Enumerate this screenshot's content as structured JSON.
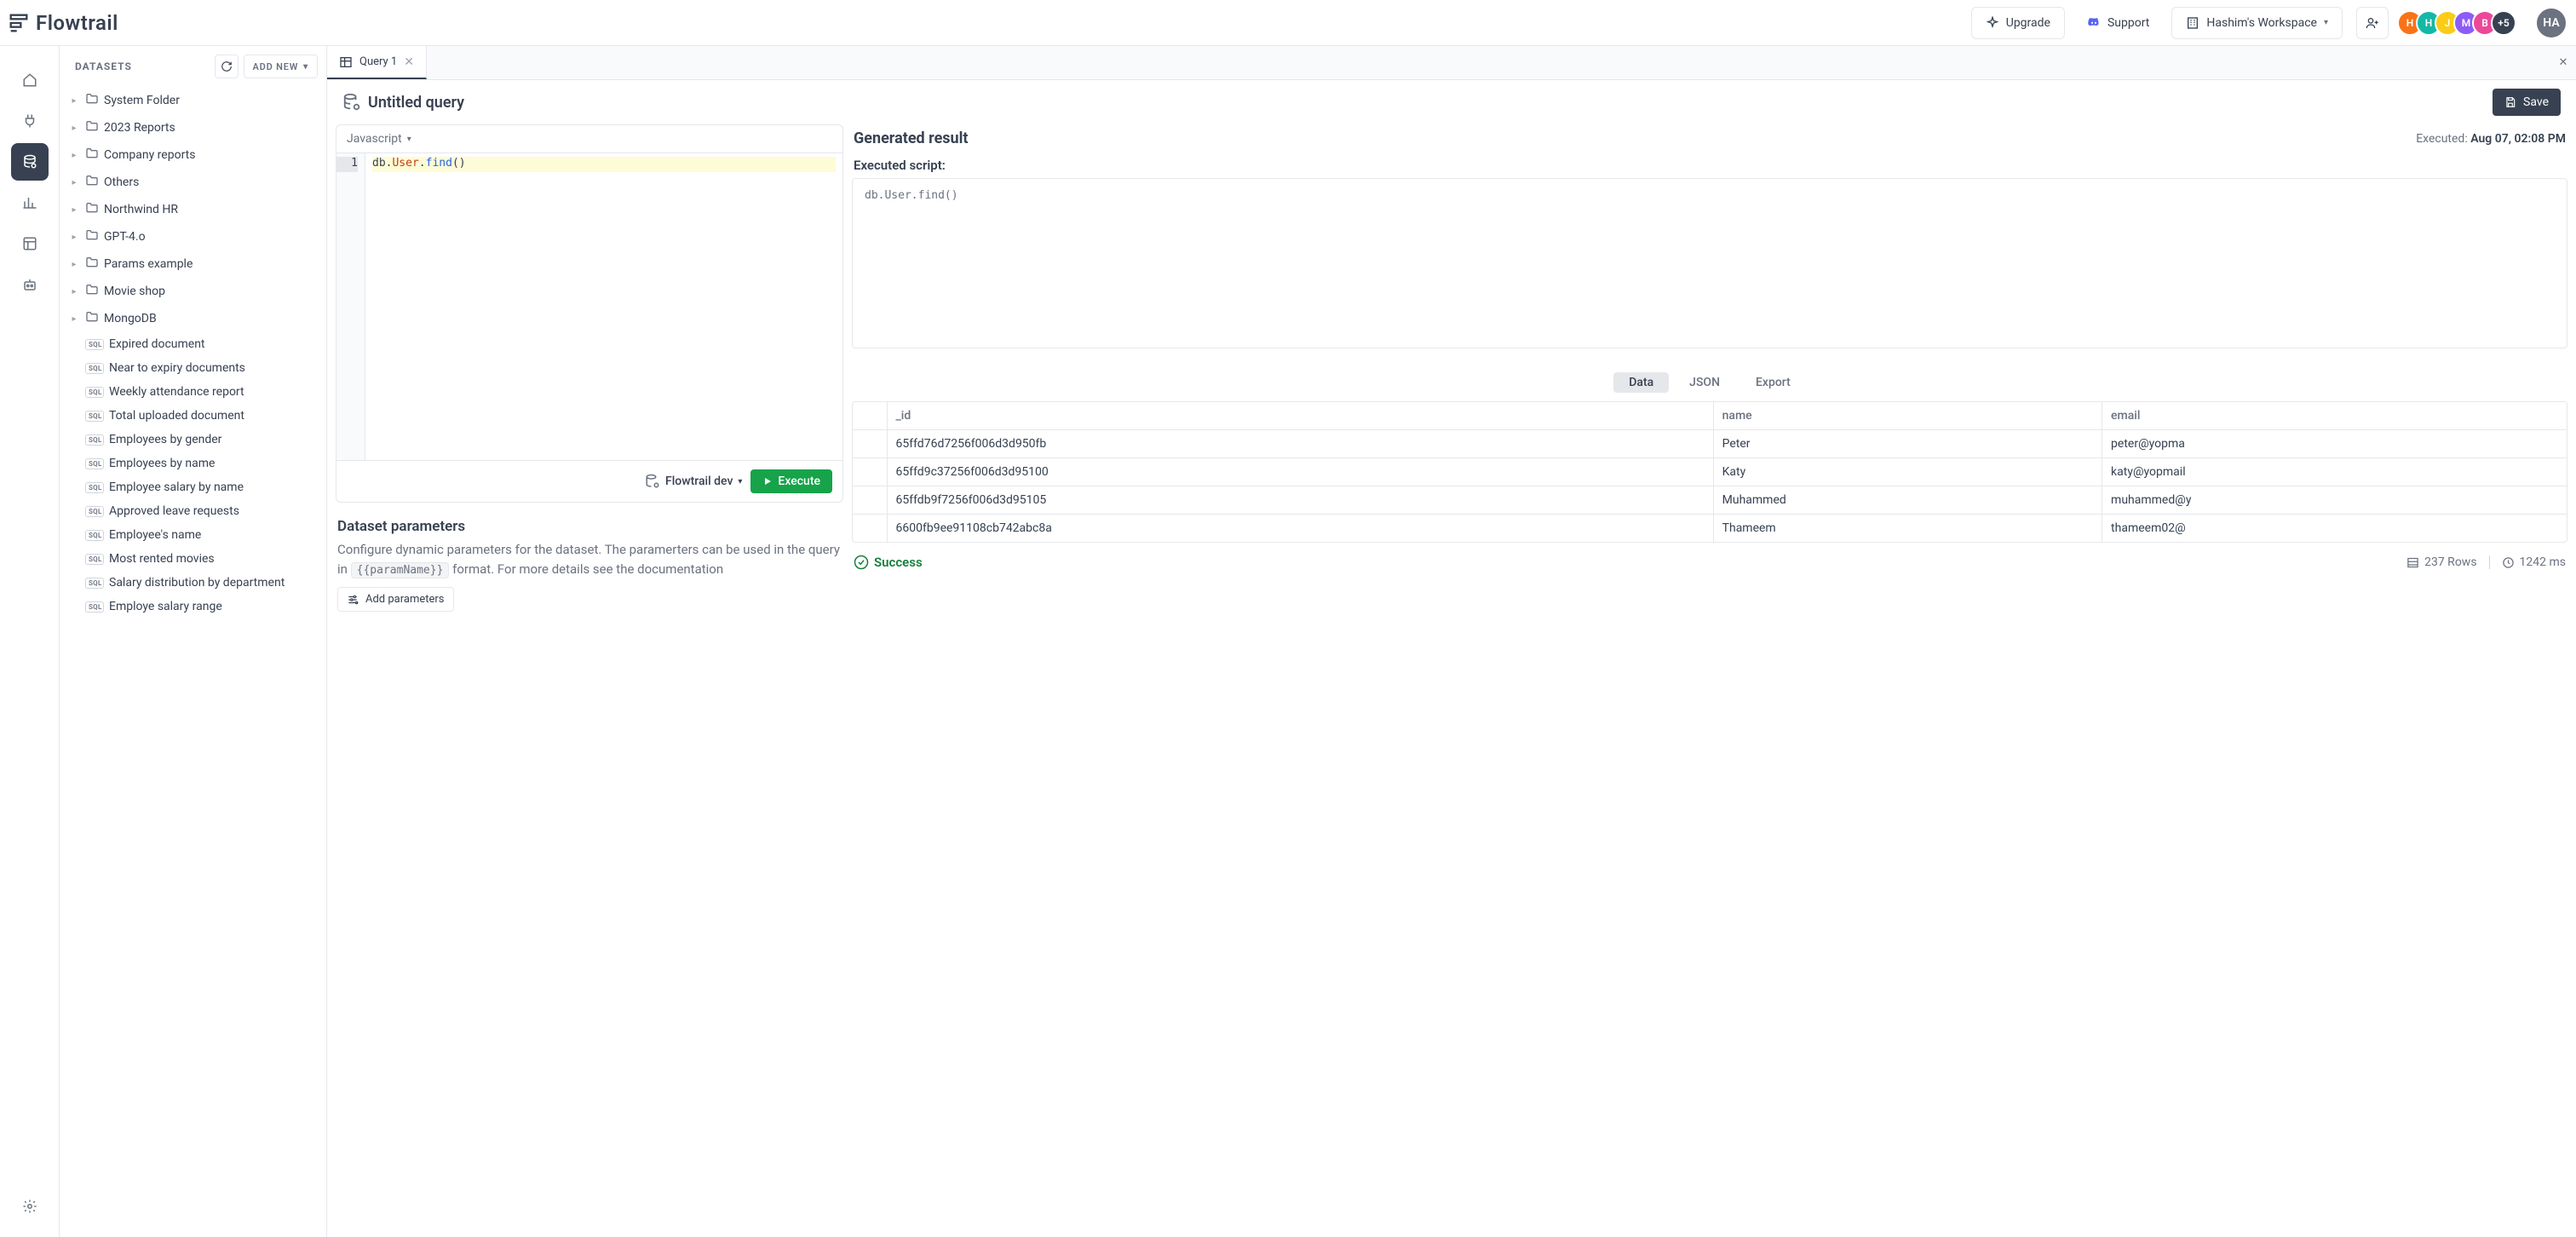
{
  "brand": {
    "name": "Flowtrail"
  },
  "topbar": {
    "upgrade_label": "Upgrade",
    "support_label": "Support",
    "workspace_label": "Hashim's Workspace",
    "avatar_overflow": "+5",
    "current_user_initials": "HA",
    "avatars": [
      {
        "initial": "H",
        "color": "#f97316"
      },
      {
        "initial": "H",
        "color": "#14b8a6"
      },
      {
        "initial": "J",
        "color": "#facc15"
      },
      {
        "initial": "M",
        "color": "#8b5cf6"
      },
      {
        "initial": "B",
        "color": "#ec4899"
      }
    ]
  },
  "sidebar": {
    "title": "DATASETS",
    "add_new_label": "ADD NEW",
    "folders": [
      {
        "label": "System Folder"
      },
      {
        "label": "2023 Reports"
      },
      {
        "label": "Company reports"
      },
      {
        "label": "Others"
      },
      {
        "label": "Northwind HR"
      },
      {
        "label": "GPT-4.o"
      },
      {
        "label": "Params example"
      },
      {
        "label": "Movie shop"
      },
      {
        "label": "MongoDB"
      }
    ],
    "queries": [
      {
        "label": "Expired document"
      },
      {
        "label": "Near to expiry documents"
      },
      {
        "label": "Weekly attendance report"
      },
      {
        "label": "Total uploaded document"
      },
      {
        "label": "Employees by gender"
      },
      {
        "label": "Employees by name"
      },
      {
        "label": "Employee salary by name"
      },
      {
        "label": "Approved leave requests"
      },
      {
        "label": "Employee's name"
      },
      {
        "label": "Most rented movies"
      },
      {
        "label": "Salary distribution by department"
      },
      {
        "label": "Employe salary range"
      }
    ],
    "sql_badge": "SQL"
  },
  "tabs": {
    "items": [
      {
        "label": "Query 1"
      }
    ]
  },
  "query": {
    "title": "Untitled query",
    "save_label": "Save",
    "language": "Javascript",
    "connection": "Flowtrail dev",
    "execute_label": "Execute",
    "code": {
      "db": "db",
      "user": "User",
      "find": "find",
      "parens": "()"
    }
  },
  "parameters": {
    "heading": "Dataset parameters",
    "desc_prefix": "Configure dynamic parameters for the dataset. The paramerters can be used in the query in ",
    "code_token": "{{paramName}}",
    "desc_suffix": " format. For more details see the ",
    "doc_link_text": "documentation",
    "add_label": "Add parameters"
  },
  "result": {
    "title": "Generated result",
    "executed_prefix": "Executed: ",
    "executed_time": "Aug 07, 02:08 PM",
    "script_label": "Executed script:",
    "script_text": "db.User.find()",
    "tabs": {
      "data": "Data",
      "json": "JSON",
      "export": "Export"
    },
    "columns": {
      "id": "_id",
      "name": "name",
      "email": "email"
    },
    "rows": [
      {
        "_id": "65ffd76d7256f006d3d950fb",
        "name": "Peter",
        "email": "peter@yopma"
      },
      {
        "_id": "65ffd9c37256f006d3d95100",
        "name": "Katy",
        "email": "katy@yopmail"
      },
      {
        "_id": "65ffdb9f7256f006d3d95105",
        "name": "Muhammed",
        "email": "muhammed@y"
      },
      {
        "_id": "6600fb9ee91108cb742abc8a",
        "name": "Thameem",
        "email": "thameem02@"
      }
    ],
    "status": {
      "success": "Success",
      "rows": "237 Rows",
      "time": "1242 ms"
    }
  }
}
